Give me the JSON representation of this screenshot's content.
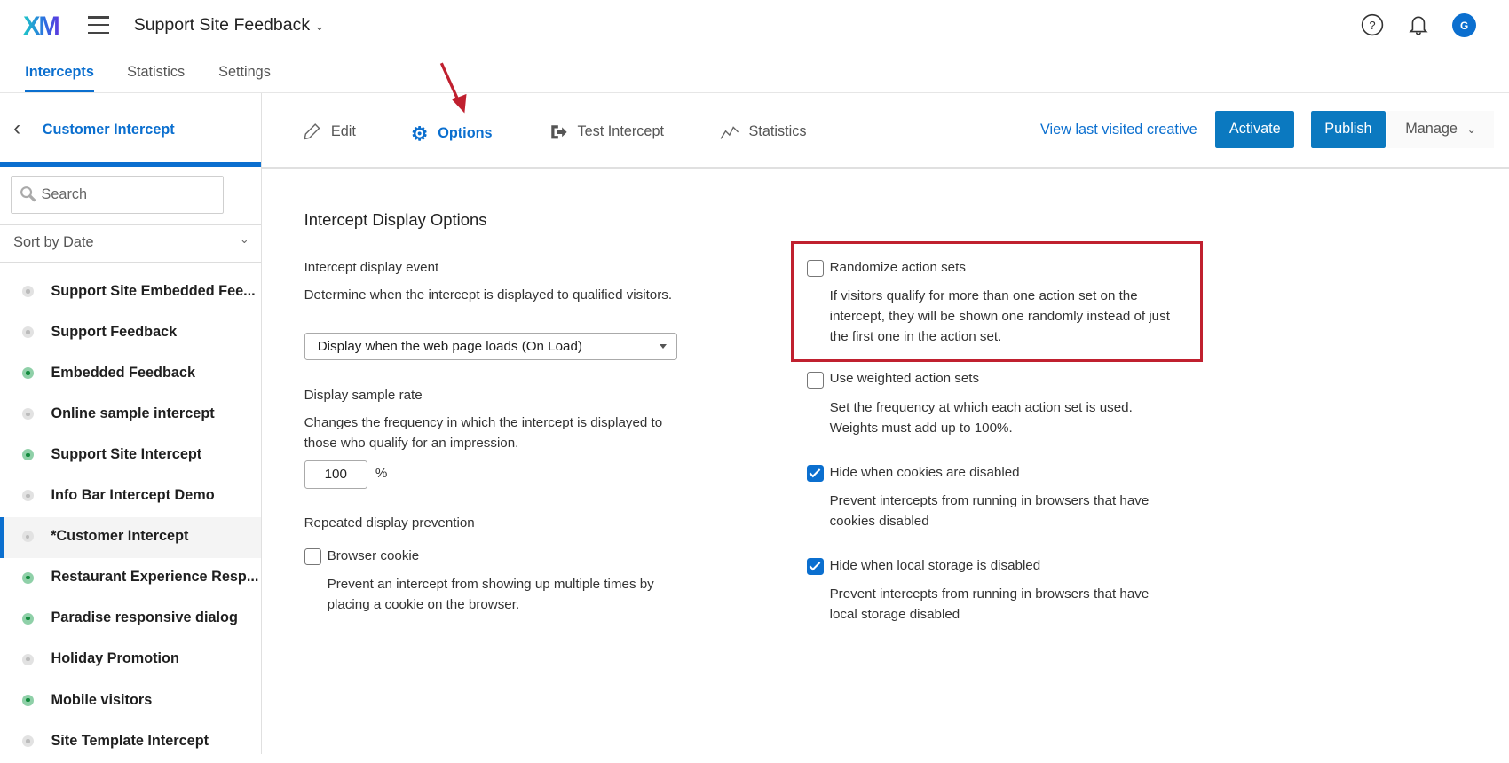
{
  "header": {
    "logo": "XM",
    "project_title": "Support Site Feedback",
    "avatar_initial": "G"
  },
  "nav_tabs": [
    {
      "label": "Intercepts",
      "active": true
    },
    {
      "label": "Statistics"
    },
    {
      "label": "Settings"
    }
  ],
  "sidebar": {
    "title": "Customer Intercept",
    "search_placeholder": "Search",
    "sort_label": "Sort by Date",
    "items": [
      {
        "label": "Support Site Embedded Fee...",
        "active": false
      },
      {
        "label": "Support Feedback",
        "active": false
      },
      {
        "label": "Embedded Feedback",
        "active": true
      },
      {
        "label": "Online sample intercept",
        "active": false
      },
      {
        "label": "Support Site Intercept",
        "active": true
      },
      {
        "label": "Info Bar Intercept Demo",
        "active": false
      },
      {
        "label": "*Customer Intercept",
        "active": false,
        "selected": true
      },
      {
        "label": "Restaurant Experience Resp...",
        "active": true
      },
      {
        "label": "Paradise responsive dialog",
        "active": true
      },
      {
        "label": "Holiday Promotion",
        "active": false
      },
      {
        "label": "Mobile visitors",
        "active": true
      },
      {
        "label": "Site Template Intercept",
        "active": false
      }
    ]
  },
  "toolbar": {
    "edit": "Edit",
    "options": "Options",
    "test": "Test Intercept",
    "statistics": "Statistics",
    "view_last": "View last visited creative",
    "activate": "Activate",
    "publish": "Publish",
    "manage": "Manage"
  },
  "options": {
    "title": "Intercept Display Options",
    "event_label": "Intercept display event",
    "event_desc": "Determine when the intercept is displayed to qualified visitors.",
    "event_value": "Display when the web page loads (On Load)",
    "rate_label": "Display sample rate",
    "rate_desc": "Changes the frequency in which the intercept is displayed to those who qualify for an impression.",
    "rate_value": "100",
    "rate_unit": "%",
    "repeat_label": "Repeated display prevention",
    "browser_cookie": {
      "label": "Browser cookie",
      "checked": false,
      "desc": "Prevent an intercept from showing up multiple times by placing a cookie on the browser."
    },
    "randomize": {
      "label": "Randomize action sets",
      "checked": false,
      "desc": "If visitors qualify for more than one action set on the intercept, they will be shown one randomly instead of just the first one in the action set."
    },
    "weighted": {
      "label": "Use weighted action sets",
      "checked": false,
      "desc": "Set the frequency at which each action set is used. Weights must add up to 100%."
    },
    "cookies": {
      "label": "Hide when cookies are disabled",
      "checked": true,
      "desc": "Prevent intercepts from running in browsers that have cookies disabled"
    },
    "storage": {
      "label": "Hide when local storage is disabled",
      "checked": true,
      "desc": "Prevent intercepts from running in browsers that have local storage disabled"
    }
  },
  "colors": {
    "accent": "#0b6fcf",
    "button": "#0b79c0",
    "highlight": "#c0202f",
    "active_dot": "#118a3c"
  }
}
